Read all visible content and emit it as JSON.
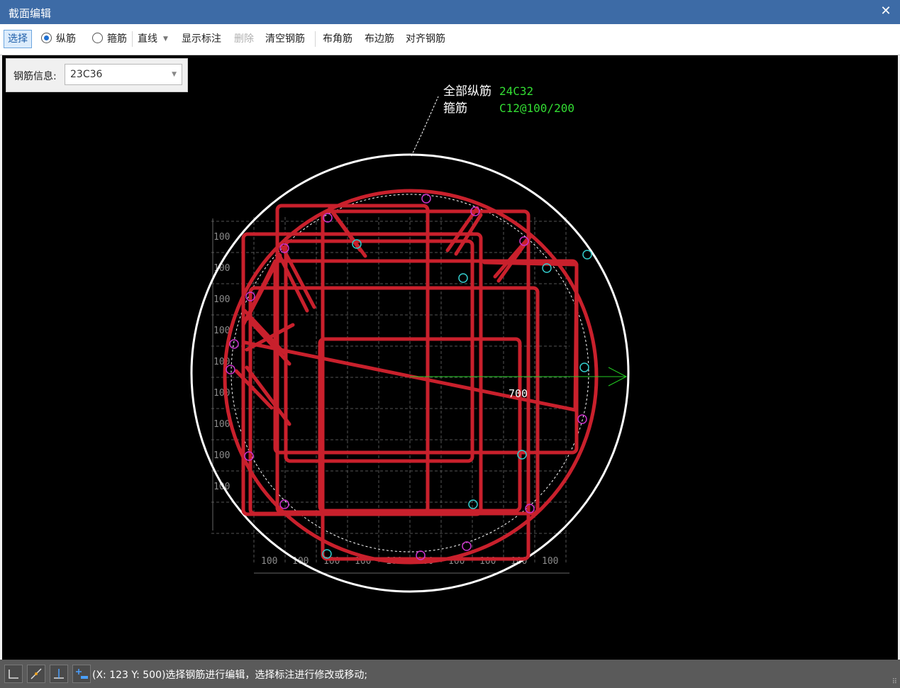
{
  "window": {
    "title": "截面编辑",
    "close_glyph": "✕"
  },
  "toolbar": {
    "select": "选择",
    "longitudinal": "纵筋",
    "stirrup": "箍筋",
    "line_mode": "直线",
    "show_annotation": "显示标注",
    "delete": "删除",
    "clear_rebar": "清空钢筋",
    "corner_rebar": "布角筋",
    "edge_rebar": "布边筋",
    "align_rebar": "对齐钢筋",
    "selected_radio": "longitudinal"
  },
  "info_panel": {
    "label": "钢筋信息:",
    "value": "23C36"
  },
  "drawing": {
    "annotation": {
      "longitudinal_label": "全部纵筋",
      "longitudinal_value": "24C32",
      "stirrup_label": "箍筋",
      "stirrup_value": "C12@100/200"
    },
    "radius_label": "700",
    "grid_label": "100",
    "colors": {
      "background": "#000000",
      "concrete_outline": "#ffffff",
      "stirrup": "#c9202c",
      "annotation_value": "#33dd33",
      "rebar_magenta": "#cc33cc",
      "rebar_cyan": "#33cccc",
      "grid": "#555555",
      "radius_line": "#22cc22"
    }
  },
  "status": {
    "message": "(X: 123 Y: 500)选择钢筋进行编辑，选择标注进行修改或移动;"
  }
}
